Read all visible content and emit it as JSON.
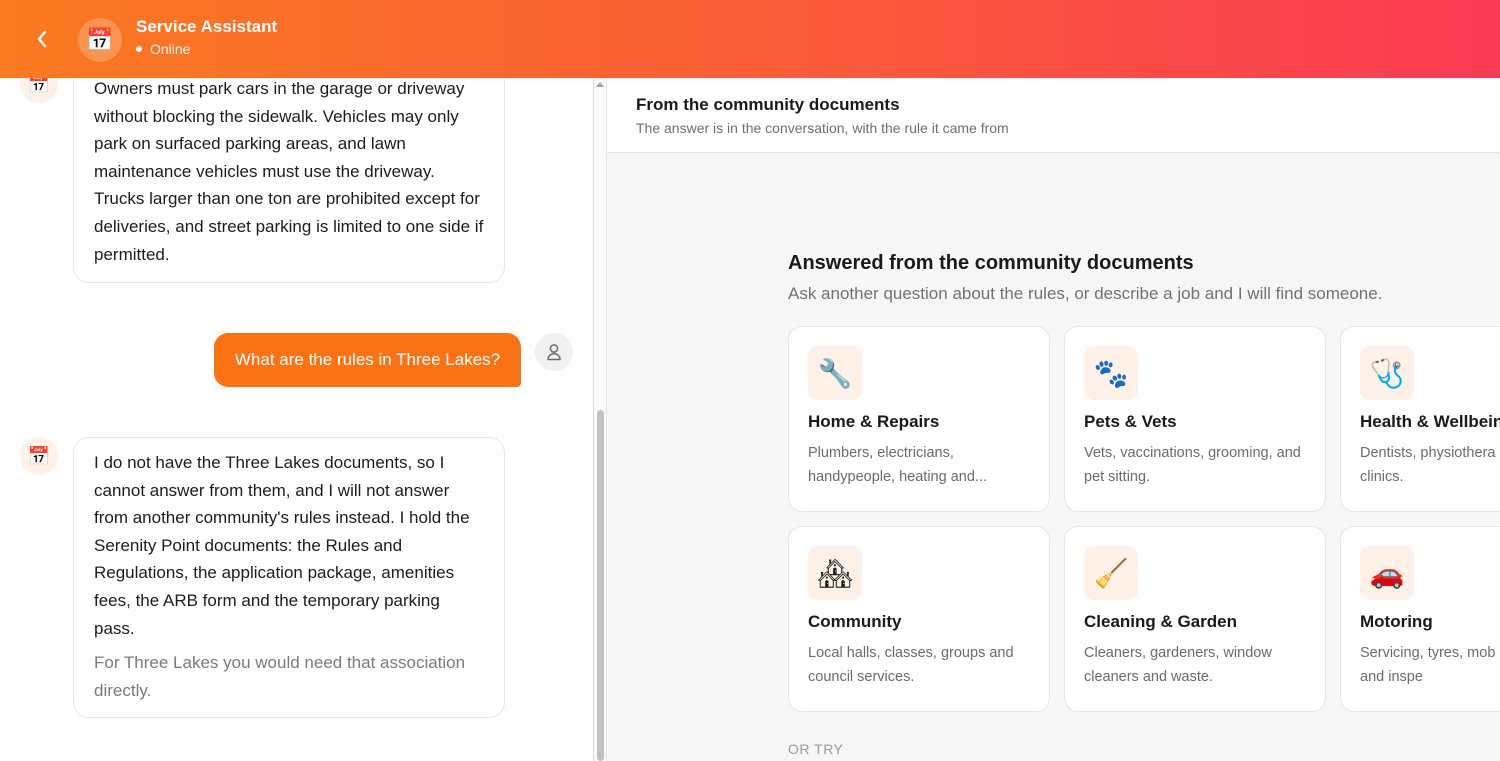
{
  "header": {
    "title": "Service Assistant",
    "status": "Online",
    "avatar_icon": "calendar-icon",
    "avatar_glyph": "📅",
    "gradient_start": "#f97a1f",
    "gradient_end": "#fb3a55"
  },
  "chat": {
    "bot_avatar_glyph": "📅",
    "messages": [
      {
        "role": "assistant",
        "text": "Owners must park cars in the garage or driveway without blocking the sidewalk. Vehicles may only park on surfaced parking areas, and lawn maintenance vehicles must use the driveway. Trucks larger than one ton are prohibited except for deliveries, and street parking is limited to one side if permitted."
      },
      {
        "role": "user",
        "text": "What are the rules in Three Lakes?"
      },
      {
        "role": "assistant",
        "text": "I do not have the Three Lakes documents, so I cannot answer from them, and I will not answer from another community's rules instead. I hold the Serenity Point documents: the Rules and Regulations, the application package, amenities fees, the ARB form and the temporary parking pass.",
        "note": "For Three Lakes you would need that association directly."
      }
    ],
    "user_bubble_color": "#f97316"
  },
  "panel": {
    "title": "From the community documents",
    "subtitle": "The answer is in the conversation, with the rule it came from",
    "answered_title": "Answered from the community documents",
    "answered_subtitle": "Ask another question about the rules, or describe a job and I will find someone.",
    "categories": [
      {
        "title": "Home & Repairs",
        "description": "Plumbers, electricians, handypeople, heating and...",
        "icon": "wrench-icon",
        "glyph": "🔧"
      },
      {
        "title": "Pets & Vets",
        "description": "Vets, vaccinations, grooming, and pet sitting.",
        "icon": "paw-icon",
        "glyph": "🐾"
      },
      {
        "title": "Health & Wellbein",
        "description": "Dentists, physiothera opticians and clinics.",
        "icon": "stethoscope-icon",
        "glyph": "🩺"
      },
      {
        "title": "Community",
        "description": "Local halls, classes, groups and council services.",
        "icon": "house-icon",
        "glyph": "🏘"
      },
      {
        "title": "Cleaning & Garden",
        "description": "Cleaners, gardeners, window cleaners and waste.",
        "icon": "broom-icon",
        "glyph": "🧹"
      },
      {
        "title": "Motoring",
        "description": "Servicing, tyres, mob mechanics and inspe",
        "icon": "car-icon",
        "glyph": "🚗"
      }
    ],
    "or_try": "OR TRY"
  }
}
